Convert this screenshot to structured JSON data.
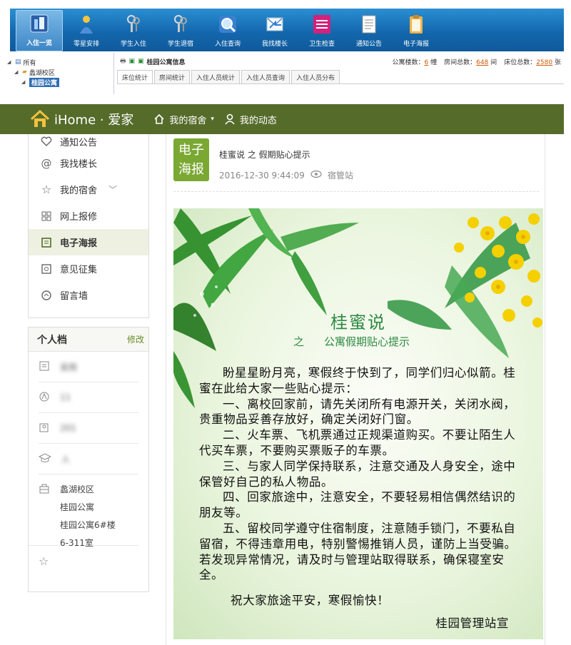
{
  "admin": {
    "toolbar": [
      {
        "label": "入住一览",
        "icon": "building-icon",
        "active": true
      },
      {
        "label": "零星安排",
        "icon": "person-icon",
        "active": false
      },
      {
        "label": "学生入住",
        "icon": "keys-icon",
        "active": false
      },
      {
        "label": "学生退宿",
        "icon": "keys-icon",
        "active": false
      },
      {
        "label": "入住查询",
        "icon": "magnifier-icon",
        "active": false
      },
      {
        "label": "我找楼长",
        "icon": "mail-icon",
        "active": false
      },
      {
        "label": "卫生检查",
        "icon": "checklist-icon",
        "active": false
      },
      {
        "label": "通知公告",
        "icon": "document-icon",
        "active": false
      },
      {
        "label": "电子海报",
        "icon": "clipboard-icon",
        "active": false
      }
    ],
    "tree": {
      "root": "所有",
      "campus": "蠡湖校区",
      "selected": "桂园公寓"
    },
    "panel_title": "桂园公寓信息",
    "stats": {
      "floors_label": "公寓楼数：",
      "floors": "6",
      "floors_unit": "幢",
      "rooms_label": "房间总数：",
      "rooms": "648",
      "rooms_unit": "间",
      "beds_label": "床位总数：",
      "beds": "2580",
      "beds_unit": "张"
    },
    "tabs": [
      "床位统计",
      "房间统计",
      "入住人员统计",
      "入住人员查询",
      "入住人员分布"
    ]
  },
  "home": {
    "brand": "iHome · 爱家",
    "nav_dorm": "我的宿舍",
    "nav_activity": "我的动态"
  },
  "sidebar": {
    "items": [
      {
        "label": "通知公告",
        "icon": "heart-icon"
      },
      {
        "label": "我找楼长",
        "icon": "at-icon"
      },
      {
        "label": "我的宿舍",
        "icon": "star-icon"
      },
      {
        "label": "网上报修",
        "icon": "grid-icon"
      },
      {
        "label": "电子海报",
        "icon": "poster-icon"
      },
      {
        "label": "意见征集",
        "icon": "feedback-icon"
      },
      {
        "label": "留言墙",
        "icon": "message-icon"
      }
    ]
  },
  "profile": {
    "title": "个人档",
    "edit": "修改",
    "name": "吴雨",
    "id": "11",
    "year": "201",
    "major": "人",
    "address": [
      "蠡湖校区",
      "桂园公寓",
      "桂园公寓6#楼",
      "6-311室"
    ]
  },
  "post": {
    "badge_line1": "电子",
    "badge_line2": "海报",
    "title": "桂蜜说 之 假期贴心提示",
    "date": "2016-12-30 9:44:09",
    "author": "宿管站"
  },
  "poster": {
    "title": "桂蜜说",
    "sub_prefix": "之",
    "subtitle": "公寓假期贴心提示",
    "paragraphs": [
      "盼星星盼月亮，寒假终于快到了，同学们归心似箭。桂蜜在此给大家一些贴心提示：",
      "一、离校回家前，请先关闭所有电源开关，关闭水阀，贵重物品妥善存放好，确定关闭好门窗。",
      "二、火车票、飞机票通过正规渠道购买。不要让陌生人代买车票，不要购买票贩子的车票。",
      "三、与家人同学保持联系，注意交通及人身安全，途中保管好自己的私人物品。",
      "四、回家旅途中，注意安全，不要轻易相信偶然结识的朋友等。",
      "五、留校同学遵守住宿制度，注意随手锁门，不要私自留宿，不得违章用电，特别警惕推销人员，谨防上当受骗。若发现异常情况，请及时与管理站取得联系，确保寝室安全。"
    ],
    "closing": "祝大家旅途平安，寒假愉快！",
    "signature": "桂园管理站宣"
  }
}
